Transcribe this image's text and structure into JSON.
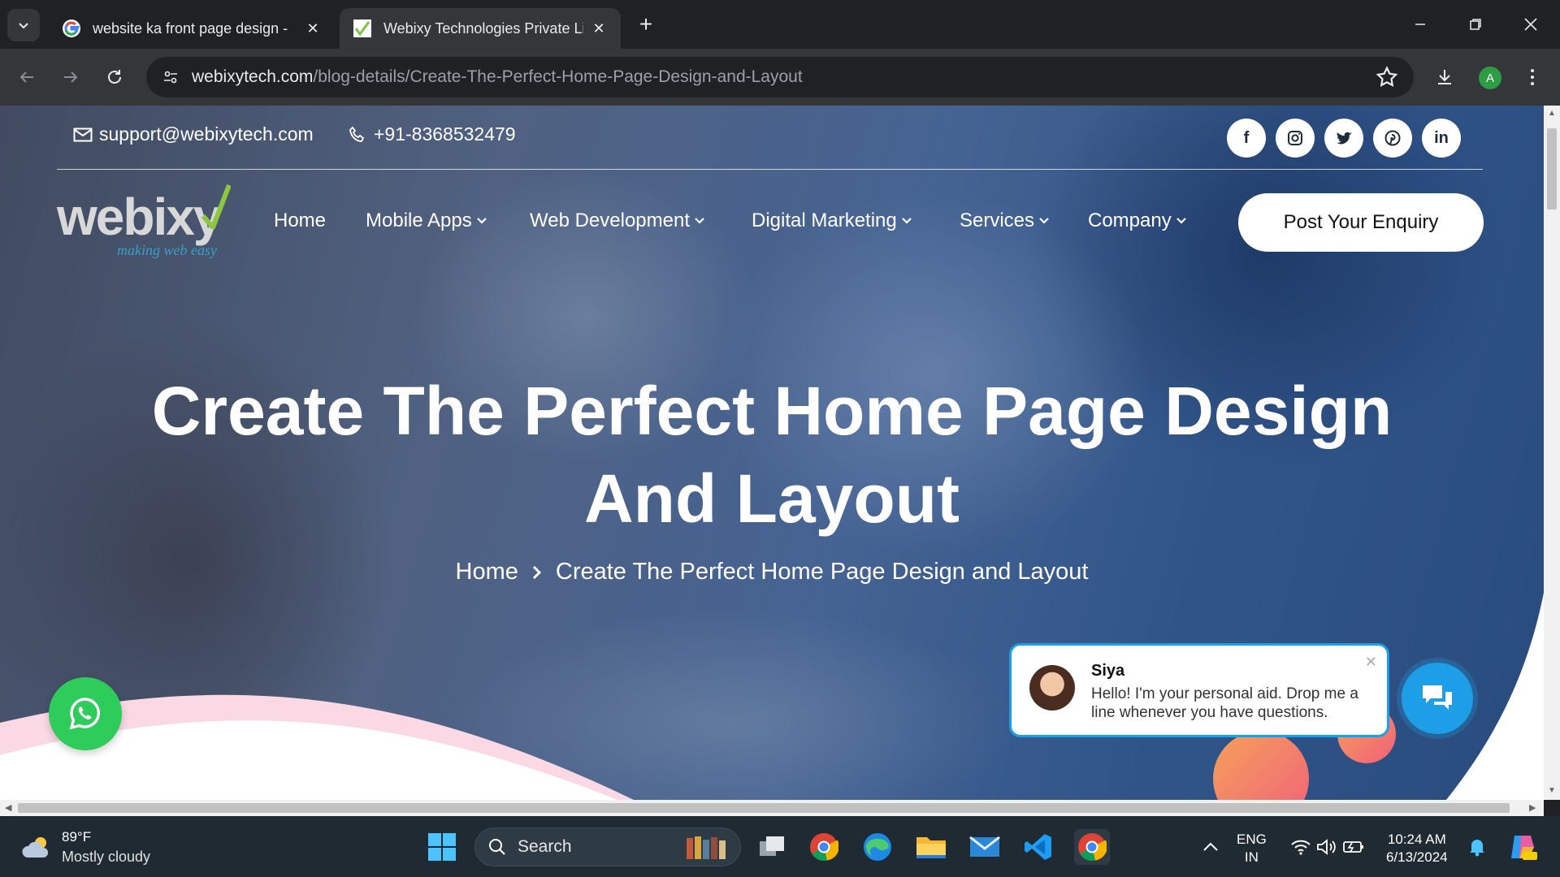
{
  "browser": {
    "tabs": [
      {
        "title": "website ka front page design - ",
        "active": false
      },
      {
        "title": "Webixy Technologies Private Lin",
        "active": true
      }
    ],
    "url_host": "webixytech.com",
    "url_path": "/blog-details/Create-The-Perfect-Home-Page-Design-and-Layout",
    "profile_initial": "A"
  },
  "topbar": {
    "email": "support@webixytech.com",
    "phone": "+91-8368532479",
    "social": [
      "facebook-icon",
      "instagram-icon",
      "twitter-icon",
      "pinterest-icon",
      "linkedin-icon"
    ]
  },
  "logo": {
    "word": "webixy",
    "tagline": "making web easy"
  },
  "nav": {
    "items": [
      "Home",
      "Mobile Apps",
      "Web Development",
      "Digital Marketing",
      "Services",
      "Company"
    ],
    "cta": "Post Your Enquiry"
  },
  "hero": {
    "title_line1": "Create The Perfect Home Page Design",
    "title_line2": "And Layout",
    "breadcrumb_home": "Home",
    "breadcrumb_current": "Create The Perfect Home Page Design and Layout"
  },
  "chat": {
    "name": "Siya",
    "message": "Hello! I'm your personal aid. Drop me a line whenever you have questions."
  },
  "taskbar": {
    "weather_temp": "89°F",
    "weather_desc": "Mostly cloudy",
    "search_placeholder": "Search",
    "lang_top": "ENG",
    "lang_bottom": "IN",
    "time": "10:24 AM",
    "date": "6/13/2024"
  },
  "colors": {
    "chrome_dark": "#202124",
    "chrome_toolbar": "#35363a",
    "whatsapp": "#2ecc5a",
    "chat_blue": "#1d9ee6",
    "taskbar": "#1f2a33"
  }
}
